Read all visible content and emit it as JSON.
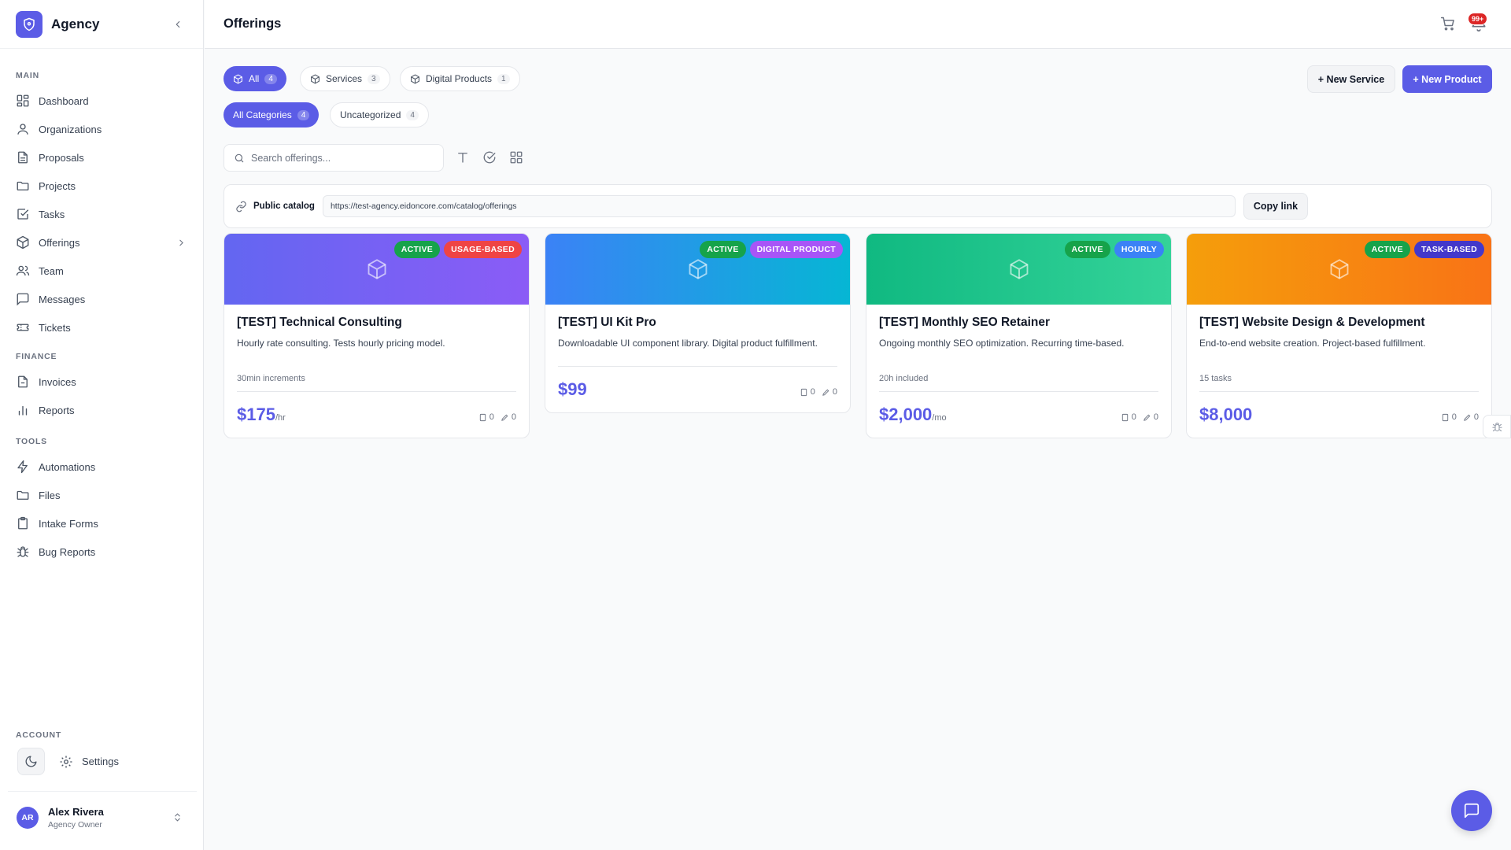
{
  "brand": {
    "name": "Agency"
  },
  "sidebar": {
    "sections": [
      {
        "title": "MAIN",
        "items": [
          {
            "label": "Dashboard",
            "icon": "dashboard-icon"
          },
          {
            "label": "Organizations",
            "icon": "user-icon"
          },
          {
            "label": "Proposals",
            "icon": "document-icon"
          },
          {
            "label": "Projects",
            "icon": "folder-icon"
          },
          {
            "label": "Tasks",
            "icon": "checkbox-icon"
          },
          {
            "label": "Offerings",
            "icon": "box-icon"
          },
          {
            "label": "Team",
            "icon": "users-icon"
          },
          {
            "label": "Messages",
            "icon": "message-icon"
          },
          {
            "label": "Tickets",
            "icon": "ticket-icon"
          }
        ]
      },
      {
        "title": "FINANCE",
        "items": [
          {
            "label": "Invoices",
            "icon": "invoice-icon"
          },
          {
            "label": "Reports",
            "icon": "bar-chart-icon"
          }
        ]
      },
      {
        "title": "TOOLS",
        "items": [
          {
            "label": "Automations",
            "icon": "bolt-icon"
          },
          {
            "label": "Files",
            "icon": "folder-icon"
          },
          {
            "label": "Intake Forms",
            "icon": "clipboard-icon"
          },
          {
            "label": "Bug Reports",
            "icon": "bug-icon"
          }
        ]
      }
    ],
    "account": {
      "title": "ACCOUNT",
      "settings_label": "Settings"
    },
    "user": {
      "initials": "AR",
      "name": "Alex Rivera",
      "role": "Agency Owner"
    }
  },
  "header": {
    "title": "Offerings",
    "notification_count": "99+"
  },
  "filters": {
    "types": [
      {
        "label": "All",
        "count": "4",
        "active": true
      },
      {
        "label": "Services",
        "count": "3",
        "active": false
      },
      {
        "label": "Digital Products",
        "count": "1",
        "active": false
      }
    ],
    "categories": [
      {
        "label": "All Categories",
        "count": "4",
        "active": true
      },
      {
        "label": "Uncategorized",
        "count": "4",
        "active": false
      }
    ]
  },
  "actions": {
    "new_service": "+ New Service",
    "new_product": "+ New Product"
  },
  "search": {
    "placeholder": "Search offerings...",
    "value": ""
  },
  "catalog": {
    "label": "Public catalog",
    "url": "https://test-agency.eidoncore.com/catalog/offerings",
    "copy_label": "Copy link"
  },
  "offerings": [
    {
      "title": "[TEST] Technical Consulting",
      "description": "Hourly rate consulting. Tests hourly pricing model.",
      "meta": "30min increments",
      "price": "$175",
      "unit": "/hr",
      "badges": [
        "ACTIVE",
        "USAGE-BASED"
      ],
      "stat_a": "0",
      "stat_b": "0"
    },
    {
      "title": "[TEST] UI Kit Pro",
      "description": "Downloadable UI component library. Digital product fulfillment.",
      "meta": "",
      "price": "$99",
      "unit": "",
      "badges": [
        "ACTIVE",
        "DIGITAL PRODUCT"
      ],
      "stat_a": "0",
      "stat_b": "0"
    },
    {
      "title": "[TEST] Monthly SEO Retainer",
      "description": "Ongoing monthly SEO optimization. Recurring time-based.",
      "meta": "20h included",
      "price": "$2,000",
      "unit": "/mo",
      "badges": [
        "ACTIVE",
        "HOURLY"
      ],
      "stat_a": "0",
      "stat_b": "0"
    },
    {
      "title": "[TEST] Website Design & Development",
      "description": "End-to-end website creation. Project-based fulfillment.",
      "meta": "15 tasks",
      "price": "$8,000",
      "unit": "",
      "badges": [
        "ACTIVE",
        "TASK-BASED"
      ],
      "stat_a": "0",
      "stat_b": "0"
    }
  ],
  "colors": {
    "accent": "#5b5ce6",
    "active_badge": "#16a34a",
    "usage_badge": "#ef4444",
    "digital_badge": "#a855f7",
    "hourly_badge": "#3b82f6",
    "task_badge": "#4338ca"
  }
}
